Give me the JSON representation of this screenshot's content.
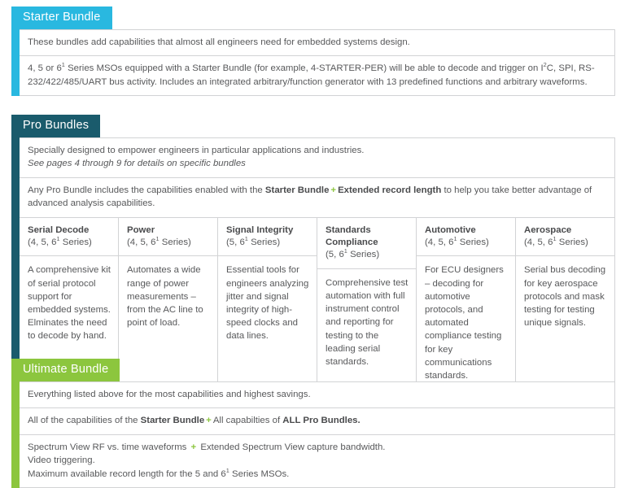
{
  "colors": {
    "starter": "#29b8e0",
    "pro": "#1a5b6c",
    "ultimate": "#8cc63e",
    "plus": "#8cc63e",
    "text": "#58595b",
    "border": "#d2d3d5"
  },
  "starter": {
    "tab_label": "Starter Bundle",
    "rows": [
      "These bundles add capabilities that almost all engineers need for embedded systems design."
    ],
    "detail_row": {
      "prefix": "4, 5 or 6",
      "superscript": "1",
      "text": " Series MSOs equipped with a Starter Bundle (for example, 4-STARTER-PER) will be able to decode and trigger on I",
      "sup2": "2",
      "text2": "C, SPI, RS-232/422/485/UART bus activity. Includes an integrated arbitrary/function generator with 13 predefined functions and arbitrary waveforms."
    }
  },
  "pro": {
    "tab_label": "Pro Bundles",
    "intro_line1": "Specially designed to empower engineers in particular applications and industries.",
    "intro_line2_italic": "See pages 4 through 9 for details on specific bundles",
    "includes_row": {
      "part1": "Any Pro Bundle includes the capabilities enabled with the ",
      "bold1": "Starter Bundle",
      "plus": "+",
      "bold2": "Extended record length",
      "part2": " to help you take better advantage of advanced analysis capabilities."
    },
    "columns": [
      {
        "title": "Serial Decode",
        "series_prefix": "(4, 5, 6",
        "series_sup": "1",
        "series_suffix": " Series)",
        "body": "A comprehensive kit of serial protocol support for embedded systems. Elminates the need to decode by hand."
      },
      {
        "title": "Power",
        "series_prefix": "(4, 5, 6",
        "series_sup": "1",
        "series_suffix": " Series)",
        "body": "Automates a wide range of power measurements – from the AC line to point of load."
      },
      {
        "title": "Signal Integrity",
        "series_prefix": "(5, 6",
        "series_sup": "1",
        "series_suffix": " Series)",
        "body": "Essential tools for engineers analyzing jitter and signal integrity of high-speed clocks and data lines."
      },
      {
        "title": "Standards Compliance",
        "series_prefix": "(5, 6",
        "series_sup": "1",
        "series_suffix": " Series)",
        "body": "Comprehensive test automation with full instrument control and reporting for testing to the leading serial standards."
      },
      {
        "title": "Automotive",
        "series_prefix": "(4, 5, 6",
        "series_sup": "1",
        "series_suffix": " Series)",
        "body": "For ECU designers – decoding for automotive protocols, and automated compliance testing for key communications standards."
      },
      {
        "title": "Aerospace",
        "series_prefix": "(4, 5, 6",
        "series_sup": "1",
        "series_suffix": " Series)",
        "body": "Serial bus decoding for key aerospace protocols and mask testing for testing unique signals."
      }
    ]
  },
  "ultimate": {
    "tab_label": "Ultimate Bundle",
    "row1": "Everything listed above for the most capabilities and highest savings.",
    "row2": {
      "part1": "All of the capabilities of the ",
      "bold1": "Starter Bundle",
      "plus": "+",
      "part2": "All capabilties of ",
      "bold2": "ALL Pro Bundles."
    },
    "row3": {
      "line1_part1": "Spectrum View RF vs. time waveforms ",
      "line1_plus": "+",
      "line1_part2": " Extended Spectrum View capture bandwidth.",
      "line2": "Video triggering.",
      "line3_prefix": "Maximum available record length for the 5 and 6",
      "line3_sup": "1",
      "line3_suffix": " Series MSOs."
    }
  }
}
